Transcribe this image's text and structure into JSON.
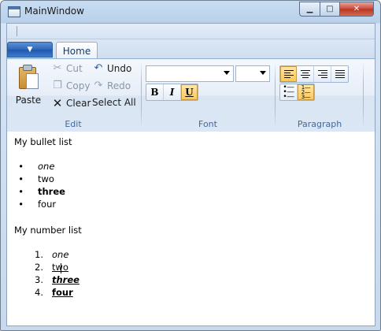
{
  "window": {
    "title": "MainWindow"
  },
  "tabs": [
    {
      "label": "Home"
    }
  ],
  "ribbon": {
    "edit": {
      "label": "Edit",
      "paste": "Paste",
      "cut": "Cut",
      "copy": "Copy",
      "clear": "Clear",
      "undo": "Undo",
      "redo": "Redo",
      "select_all": "Select All"
    },
    "font": {
      "label": "Font",
      "family": "",
      "size": "",
      "bold": "B",
      "italic": "I",
      "underline": "U"
    },
    "paragraph": {
      "label": "Paragraph"
    }
  },
  "document": {
    "bullet_heading": "My bullet list",
    "bullet_items": [
      "one",
      "two",
      "three",
      "four"
    ],
    "number_heading": "My number list",
    "number_items": [
      "one",
      "two",
      "three",
      "four"
    ],
    "number_markers": [
      "1.",
      "2.",
      "3.",
      "4."
    ],
    "bullet_marker": "•"
  },
  "colors": {
    "accent_active": "#ffc857",
    "group_label": "#3e6aa0"
  }
}
